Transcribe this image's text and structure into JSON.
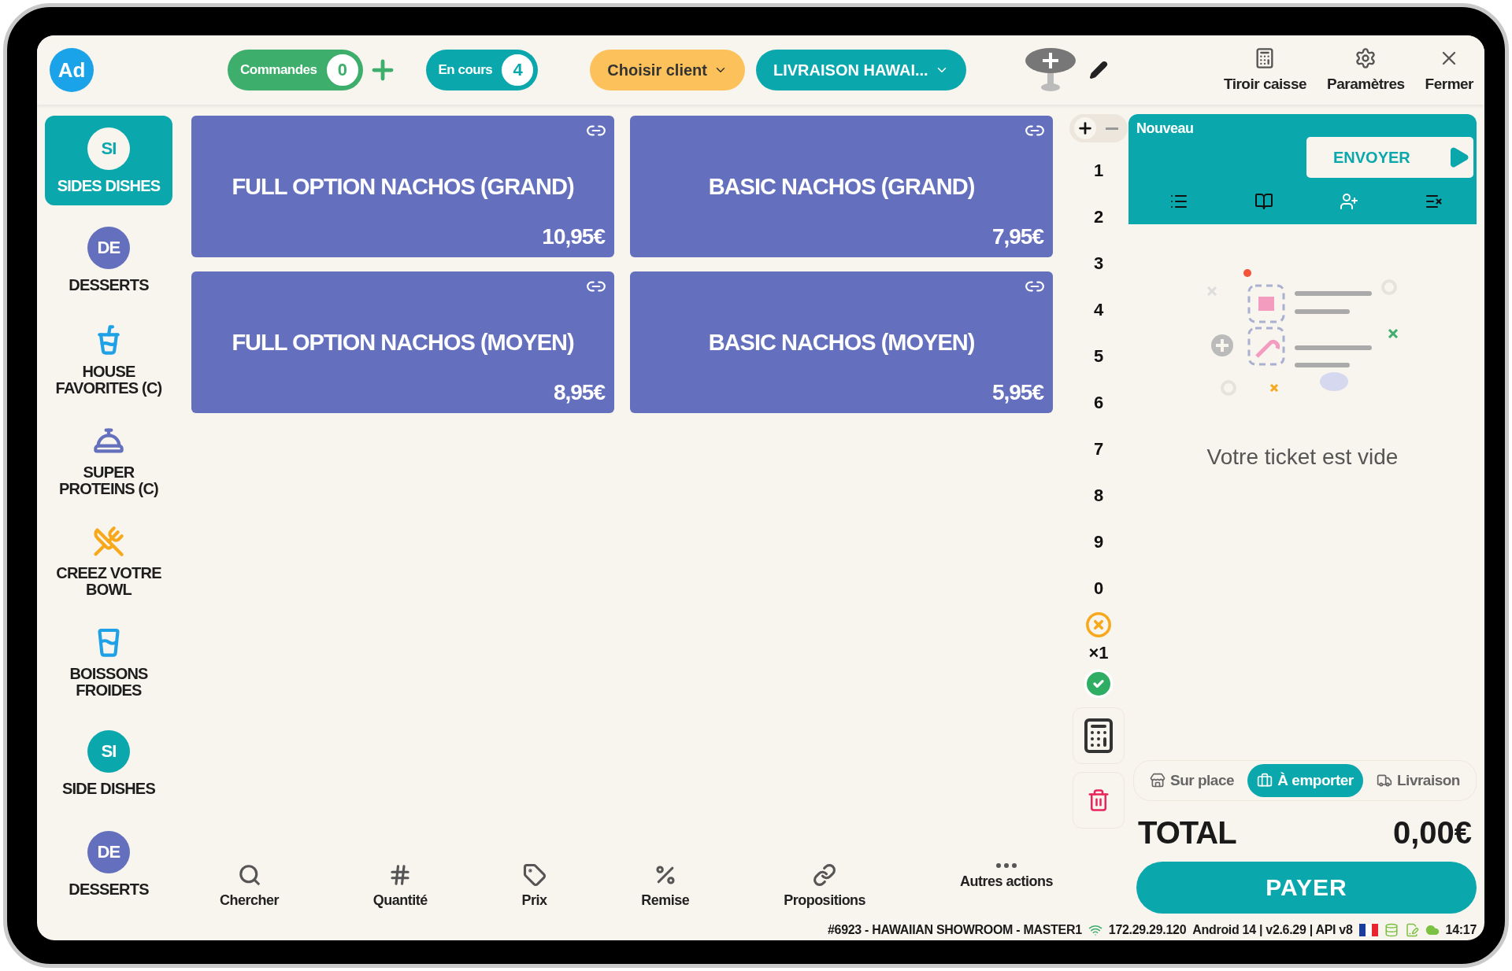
{
  "header": {
    "avatar": "Ad",
    "counters": [
      {
        "label": "Commandes",
        "count": "0",
        "color": "#3dae6b",
        "add": true
      },
      {
        "label": "En cours",
        "count": "4",
        "color": "#0aa8ad",
        "add": false
      }
    ],
    "client_button": "Choisir client",
    "mode_button": "LIVRAISON HAWAI...",
    "actions": [
      {
        "label": "Tiroir caisse",
        "kind": "calculator"
      },
      {
        "label": "Paramètres",
        "kind": "gear"
      },
      {
        "label": "Fermer",
        "kind": "close"
      }
    ]
  },
  "categories": [
    {
      "label": "SIDES DISHES",
      "kind": "badge",
      "badge": "SI",
      "color": "#0aa8ad",
      "selected": true
    },
    {
      "label": "DESSERTS",
      "kind": "badge",
      "badge": "DE",
      "color": "#6470bd",
      "selected": false
    },
    {
      "label": "HOUSE FAVORITES (C)",
      "kind": "burger-drink",
      "color": "#1ea1e6",
      "selected": false
    },
    {
      "label": "SUPER PROTEINS (C)",
      "kind": "cloche",
      "color": "#6470bd",
      "selected": false
    },
    {
      "label": "CREEZ VOTRE BOWL",
      "kind": "plate",
      "color": "#f7a81b",
      "selected": false
    },
    {
      "label": "BOISSONS FROIDES",
      "kind": "drink",
      "color": "#1ea1e6",
      "selected": false
    },
    {
      "label": "SIDE DISHES",
      "kind": "badge",
      "badge": "SI",
      "color": "#0aa8ad",
      "selected": false
    },
    {
      "label": "DESSERTS",
      "kind": "badge",
      "badge": "DE",
      "color": "#6470bd",
      "selected": false
    }
  ],
  "products": [
    {
      "name": "FULL OPTION NACHOS (GRAND)",
      "price": "10,95€"
    },
    {
      "name": "BASIC NACHOS (GRAND)",
      "price": "7,95€"
    },
    {
      "name": "FULL OPTION NACHOS (MOYEN)",
      "price": "8,95€"
    },
    {
      "name": "BASIC NACHOS (MOYEN)",
      "price": "5,95€"
    }
  ],
  "keypad": {
    "keys": [
      "1",
      "2",
      "3",
      "4",
      "5",
      "6",
      "7",
      "8",
      "9",
      "0"
    ],
    "multiplier": "×1"
  },
  "ticket": {
    "title": "Nouveau",
    "send": "ENVOYER",
    "empty": "Votre ticket est vide",
    "modes": [
      {
        "label": "Sur place",
        "kind": "store",
        "selected": false
      },
      {
        "label": "À emporter",
        "kind": "bag",
        "selected": true
      },
      {
        "label": "Livraison",
        "kind": "truck",
        "selected": false
      }
    ],
    "total_label": "TOTAL",
    "total": "0,00€",
    "pay": "PAYER"
  },
  "toolbar": [
    {
      "label": "Chercher",
      "kind": "search"
    },
    {
      "label": "Quantité",
      "kind": "hash"
    },
    {
      "label": "Prix",
      "kind": "tag"
    },
    {
      "label": "Remise",
      "kind": "percent"
    },
    {
      "label": "Propositions",
      "kind": "link"
    },
    {
      "label": "Autres actions",
      "kind": "more"
    }
  ],
  "status_bar": {
    "site": "#6923 - HAWAIIAN SHOWROOM - MASTER1",
    "ip": "172.29.29.120",
    "system": "Android 14  |  v2.6.29 | API v8",
    "time": "14:17"
  }
}
